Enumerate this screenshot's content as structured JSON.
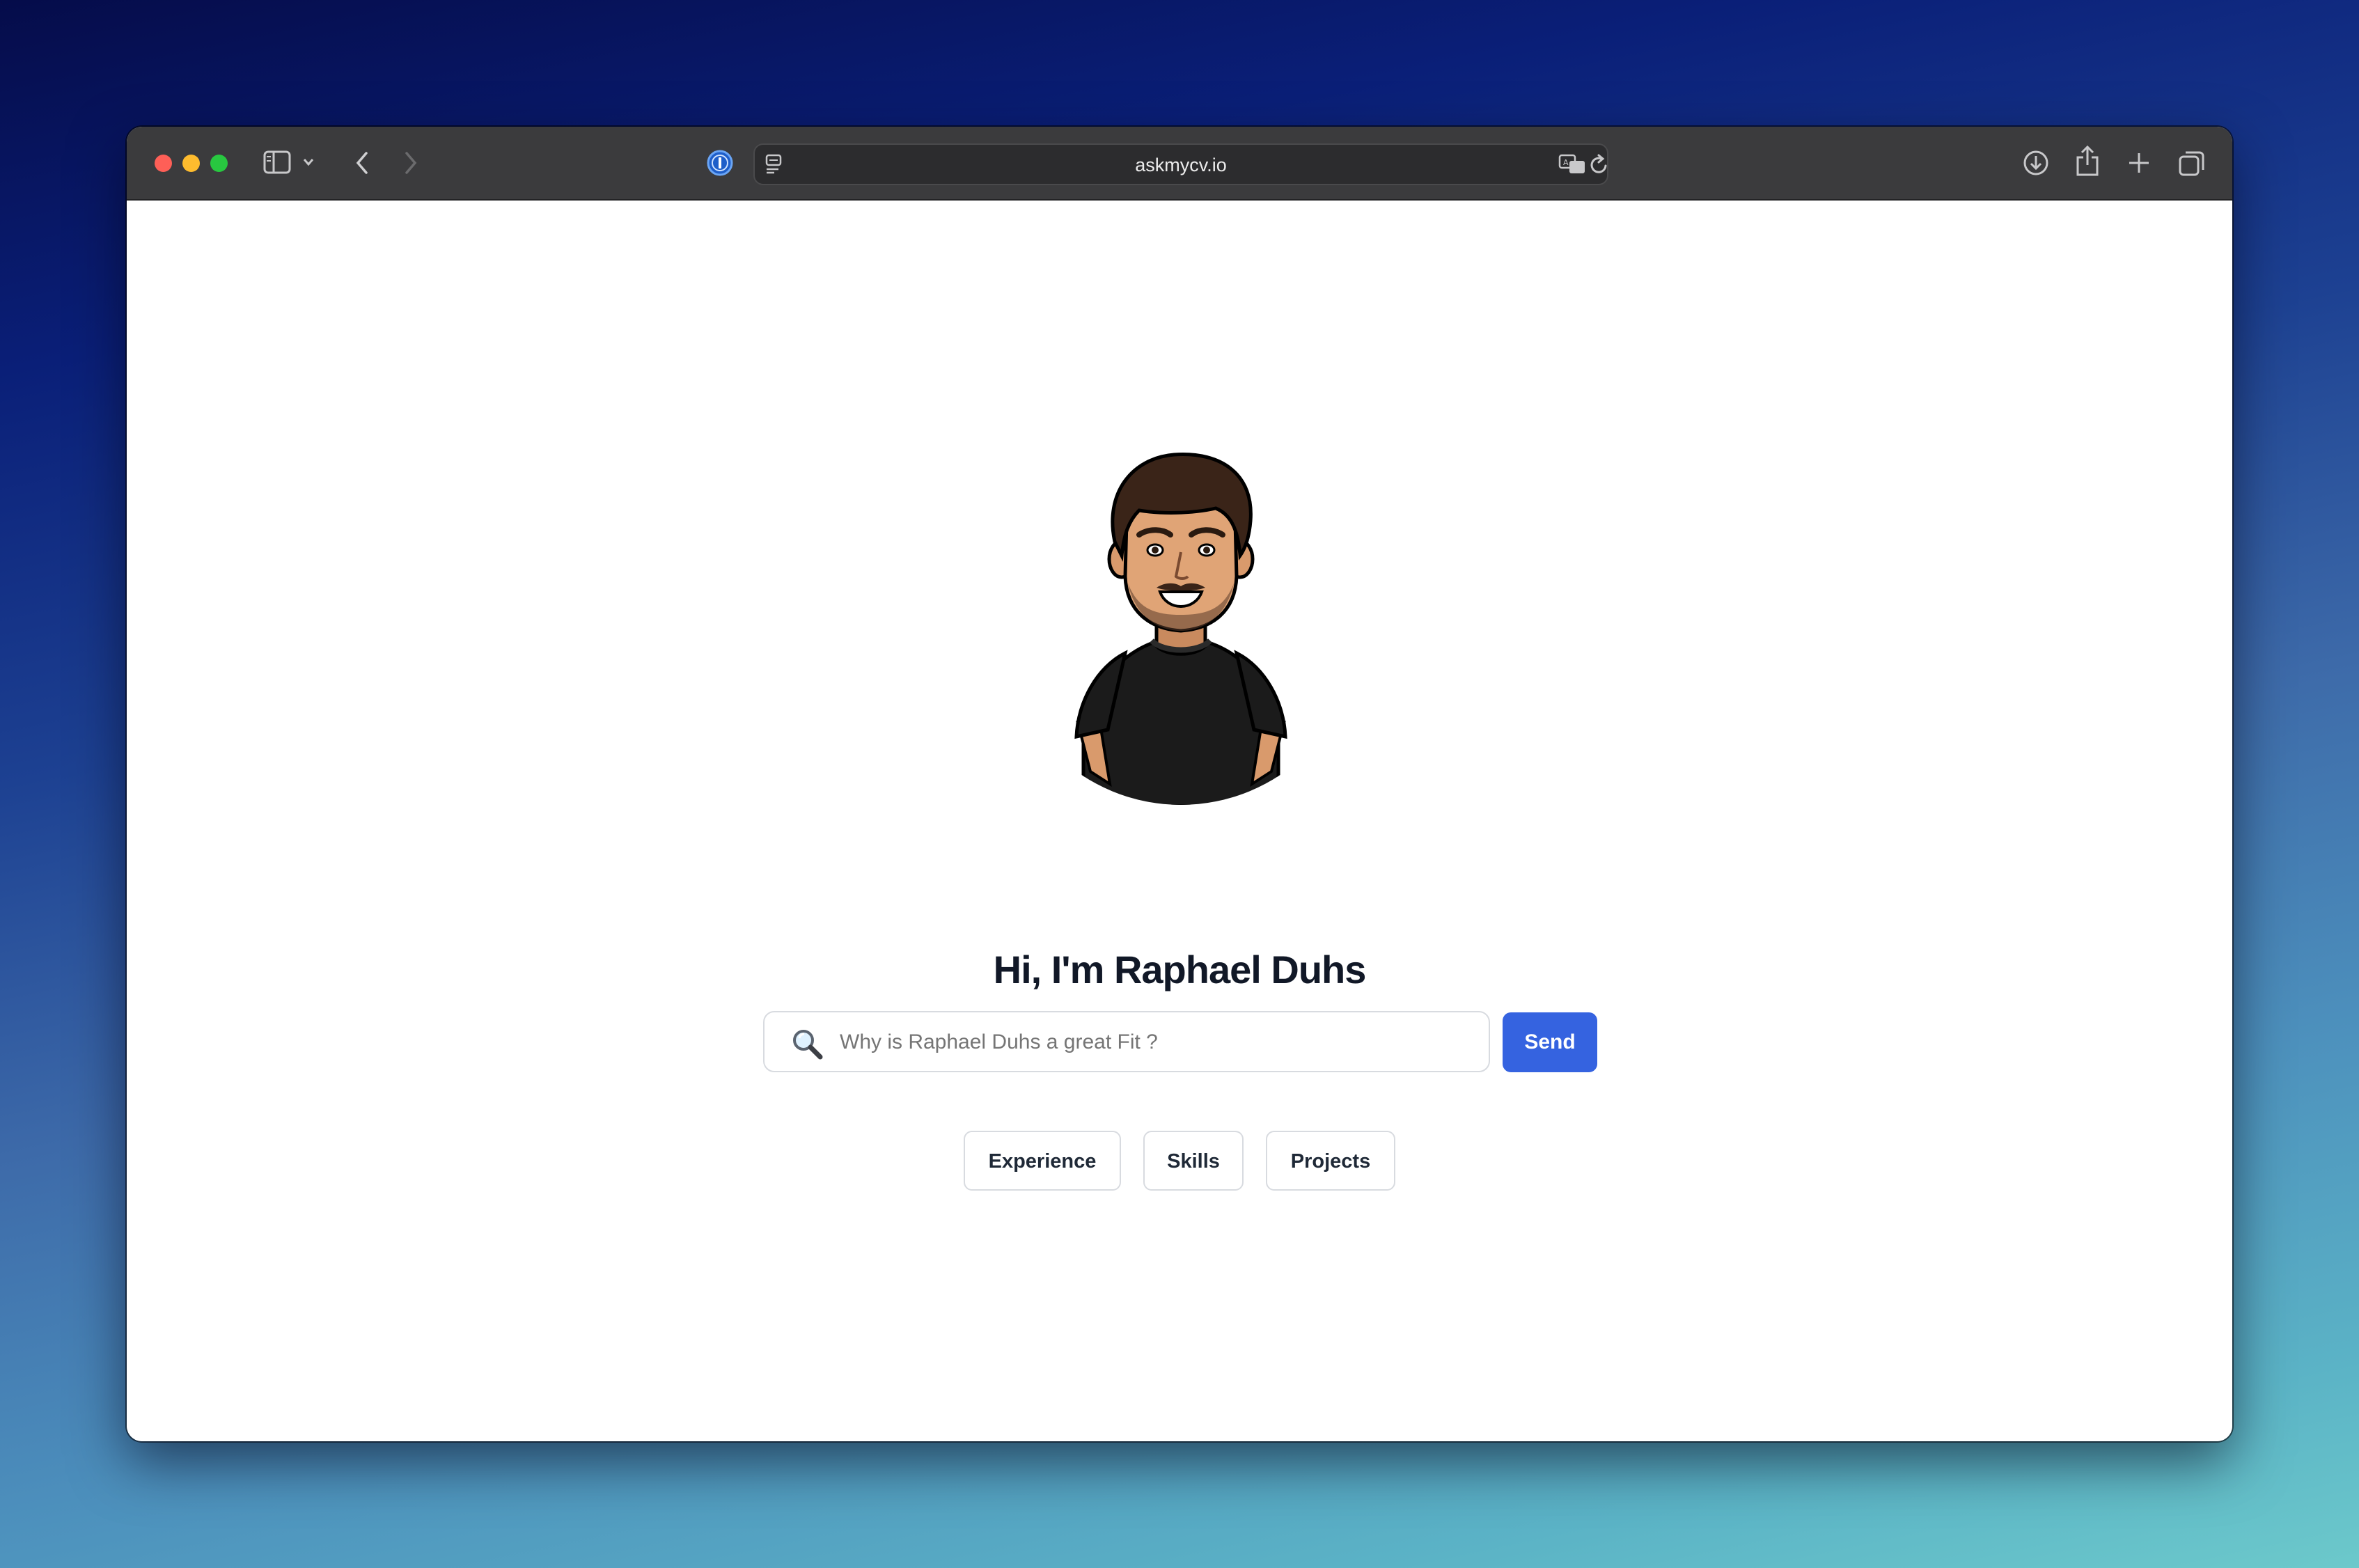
{
  "browser": {
    "url": "askmycv.io",
    "icons": [
      "sidebar-icon",
      "chevron-down-icon",
      "back-icon",
      "forward-icon",
      "password-manager-icon",
      "reader-icon",
      "translate-icon",
      "reload-icon",
      "download-icon",
      "share-icon",
      "new-tab-icon",
      "tabs-overview-icon"
    ]
  },
  "page": {
    "title": "Hi, I'm Raphael Duhs",
    "search": {
      "placeholder": "Why is Raphael Duhs a great Fit ?",
      "value": ""
    },
    "send_label": "Send",
    "chips": [
      "Experience",
      "Skills",
      "Projects"
    ]
  },
  "colors": {
    "accent": "#3563e0",
    "title": "#111827",
    "toolbar": "#3b3b3d"
  }
}
